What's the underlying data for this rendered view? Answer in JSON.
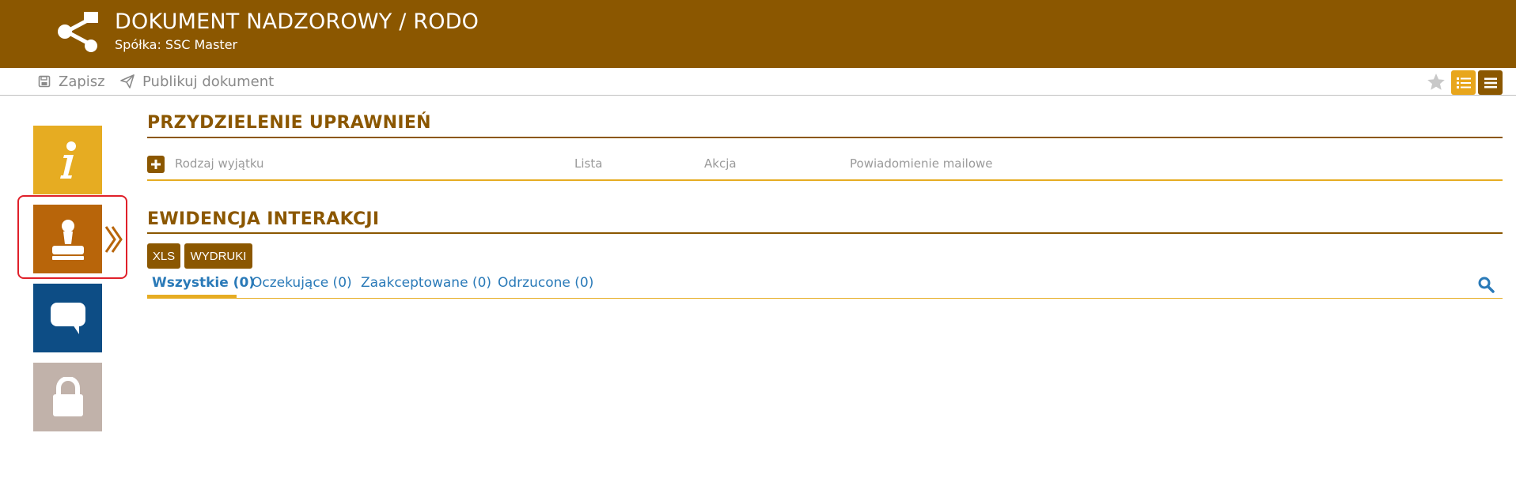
{
  "header": {
    "title": "DOKUMENT NADZOROWY / RODO",
    "subtitle": "Spółka: SSC Master",
    "logo_icon": "share-icon"
  },
  "toolbar": {
    "save_label": "Zapisz",
    "save_icon": "floppy-disk-icon",
    "publish_label": "Publikuj dokument",
    "publish_icon": "paper-plane-icon",
    "right_icons": [
      "star-icon",
      "list-view-icon",
      "menu-icon"
    ]
  },
  "sidebar": {
    "items": [
      {
        "icon": "info-icon",
        "color": "#e6ac22"
      },
      {
        "icon": "stamp-icon",
        "color": "#b8650a",
        "active": true
      },
      {
        "icon": "chat-icon",
        "color": "#0d4d85"
      },
      {
        "icon": "lock-icon",
        "color": "#c1b2aa"
      }
    ]
  },
  "permissions": {
    "title": "PRZYDZIELENIE UPRAWNIEŃ",
    "columns": [
      "Rodzaj wyjątku",
      "Lista",
      "Akcja",
      "Powiadomienie mailowe"
    ]
  },
  "interactions": {
    "title": "EWIDENCJA INTERAKCJI",
    "buttons": {
      "xls": "XLS",
      "prints": "WYDRUKI"
    },
    "tabs": [
      {
        "label": "Wszystkie (0)",
        "active": true
      },
      {
        "label": "Oczekujące (0)"
      },
      {
        "label": "Zaakceptowane (0)"
      },
      {
        "label": "Odrzucone (0)"
      }
    ]
  },
  "colors": {
    "brand": "#8b5700",
    "accent": "#e6ac22",
    "link": "#2a7ab8"
  }
}
